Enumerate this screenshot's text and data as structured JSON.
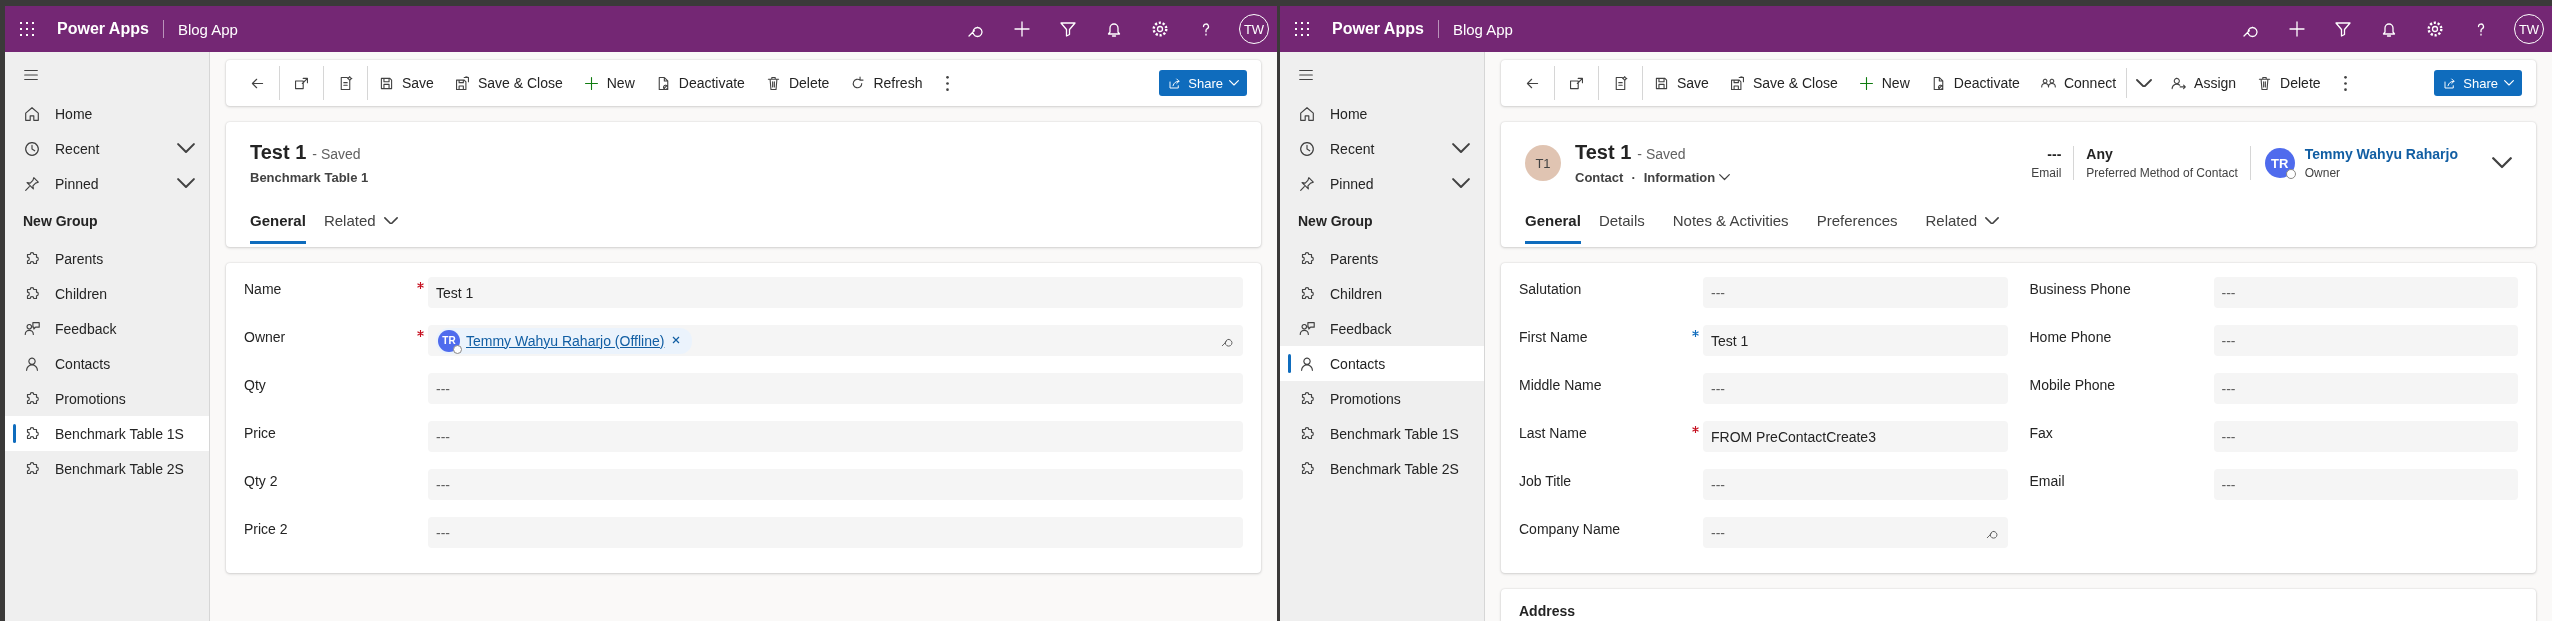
{
  "windows": [
    {
      "app_bar": {
        "app_name": "Power Apps",
        "app_title": "Blog App",
        "user_initials": "TW"
      },
      "sidebar": {
        "items": [
          {
            "label": "Home",
            "kind": "link",
            "selected": false
          },
          {
            "label": "Recent",
            "kind": "flyout",
            "selected": false
          },
          {
            "label": "Pinned",
            "kind": "flyout",
            "selected": false
          }
        ],
        "group_title": "New Group",
        "group_items": [
          {
            "label": "Parents",
            "selected": false
          },
          {
            "label": "Children",
            "selected": false
          },
          {
            "label": "Feedback",
            "selected": false
          },
          {
            "label": "Contacts",
            "selected": false
          },
          {
            "label": "Promotions",
            "selected": false
          },
          {
            "label": "Benchmark Table 1S",
            "selected": true
          },
          {
            "label": "Benchmark Table 2S",
            "selected": false
          }
        ]
      },
      "command_bar": {
        "commands": [
          {
            "label": "Save",
            "kind": "command"
          },
          {
            "label": "Save & Close",
            "kind": "command"
          },
          {
            "label": "New",
            "kind": "command"
          },
          {
            "label": "Deactivate",
            "kind": "command"
          },
          {
            "label": "Delete",
            "kind": "command"
          },
          {
            "label": "Refresh",
            "kind": "command"
          }
        ],
        "share_button": "Share"
      },
      "header": {
        "title": "Test 1",
        "status": "- Saved",
        "subtitle": "Benchmark Table 1"
      },
      "tabs": [
        {
          "label": "General",
          "kind": "tab",
          "selected": true
        },
        {
          "label": "Related",
          "kind": "dropdown",
          "selected": false
        }
      ],
      "form": {
        "columns": [
          [
            {
              "label": "Name",
              "asterisk": true,
              "color": "#c50f1f",
              "kind": "text",
              "value": "Test 1"
            },
            {
              "label": "Owner",
              "asterisk": true,
              "color": "#c50f1f",
              "kind": "lookup",
              "tag": {
                "initials": "TR",
                "name": "Temmy Wahyu Raharjo (Offline)"
              }
            },
            {
              "label": "Qty",
              "asterisk": false,
              "kind": "text",
              "placeholder": "---"
            },
            {
              "label": "Price",
              "asterisk": false,
              "kind": "text",
              "placeholder": "---"
            },
            {
              "label": "Qty 2",
              "asterisk": false,
              "kind": "text",
              "placeholder": "---"
            },
            {
              "label": "Price 2",
              "asterisk": false,
              "kind": "text",
              "placeholder": "---"
            }
          ]
        ]
      }
    },
    {
      "app_bar": {
        "app_name": "Power Apps",
        "app_title": "Blog App",
        "user_initials": "TW"
      },
      "sidebar": {
        "items": [
          {
            "label": "Home",
            "kind": "link",
            "selected": false
          },
          {
            "label": "Recent",
            "kind": "flyout",
            "selected": false
          },
          {
            "label": "Pinned",
            "kind": "flyout",
            "selected": false
          }
        ],
        "group_title": "New Group",
        "group_items": [
          {
            "label": "Parents",
            "selected": false
          },
          {
            "label": "Children",
            "selected": false
          },
          {
            "label": "Feedback",
            "selected": false
          },
          {
            "label": "Contacts",
            "selected": true
          },
          {
            "label": "Promotions",
            "selected": false
          },
          {
            "label": "Benchmark Table 1S",
            "selected": false
          },
          {
            "label": "Benchmark Table 2S",
            "selected": false
          }
        ]
      },
      "command_bar": {
        "commands": [
          {
            "label": "Save",
            "kind": "command"
          },
          {
            "label": "Save & Close",
            "kind": "command"
          },
          {
            "label": "New",
            "kind": "command"
          },
          {
            "label": "Deactivate",
            "kind": "command"
          },
          {
            "label": "Connect",
            "kind": "split"
          },
          {
            "label": "Assign",
            "kind": "command"
          },
          {
            "label": "Delete",
            "kind": "command"
          }
        ],
        "share_button": "Share"
      },
      "header": {
        "avatar_initials": "T1",
        "title": "Test 1",
        "status": "- Saved",
        "entity": "Contact",
        "separator": "·",
        "form_selector": "Information",
        "fields": [
          {
            "value": "---",
            "label": "Email"
          },
          {
            "value": "Any",
            "label": "Preferred Method of Contact"
          }
        ],
        "owner": {
          "initials": "TR",
          "name": "Temmy Wahyu Raharjo",
          "label": "Owner"
        }
      },
      "tabs": [
        {
          "label": "General",
          "kind": "tab",
          "selected": true
        },
        {
          "label": "Details",
          "kind": "tab",
          "selected": false
        },
        {
          "label": "Notes & Activities",
          "kind": "tab",
          "selected": false
        },
        {
          "label": "Preferences",
          "kind": "tab",
          "selected": false
        },
        {
          "label": "Related",
          "kind": "dropdown",
          "selected": false
        }
      ],
      "form": {
        "columns": [
          [
            {
              "label": "Salutation",
              "asterisk": false,
              "kind": "text",
              "placeholder": "---"
            },
            {
              "label": "First Name",
              "asterisk": true,
              "color": "#0f6cbd",
              "kind": "text",
              "value": "Test 1"
            },
            {
              "label": "Middle Name",
              "asterisk": false,
              "kind": "text",
              "placeholder": "---"
            },
            {
              "label": "Last Name",
              "asterisk": true,
              "color": "#c50f1f",
              "kind": "text",
              "value": "FROM PreContactCreate3"
            },
            {
              "label": "Job Title",
              "asterisk": false,
              "kind": "text",
              "placeholder": "---"
            },
            {
              "label": "Company Name",
              "asterisk": false,
              "kind": "lookup",
              "placeholder": "---"
            }
          ],
          [
            {
              "label": "Business Phone",
              "asterisk": false,
              "kind": "text",
              "placeholder": "---"
            },
            {
              "label": "Home Phone",
              "asterisk": false,
              "kind": "text",
              "placeholder": "---"
            },
            {
              "label": "Mobile Phone",
              "asterisk": false,
              "kind": "text",
              "placeholder": "---"
            },
            {
              "label": "Fax",
              "asterisk": false,
              "kind": "text",
              "placeholder": "---"
            },
            {
              "label": "Email",
              "asterisk": false,
              "kind": "text",
              "placeholder": "---"
            }
          ]
        ],
        "sections": [
          {
            "title": "Address"
          }
        ]
      }
    }
  ]
}
